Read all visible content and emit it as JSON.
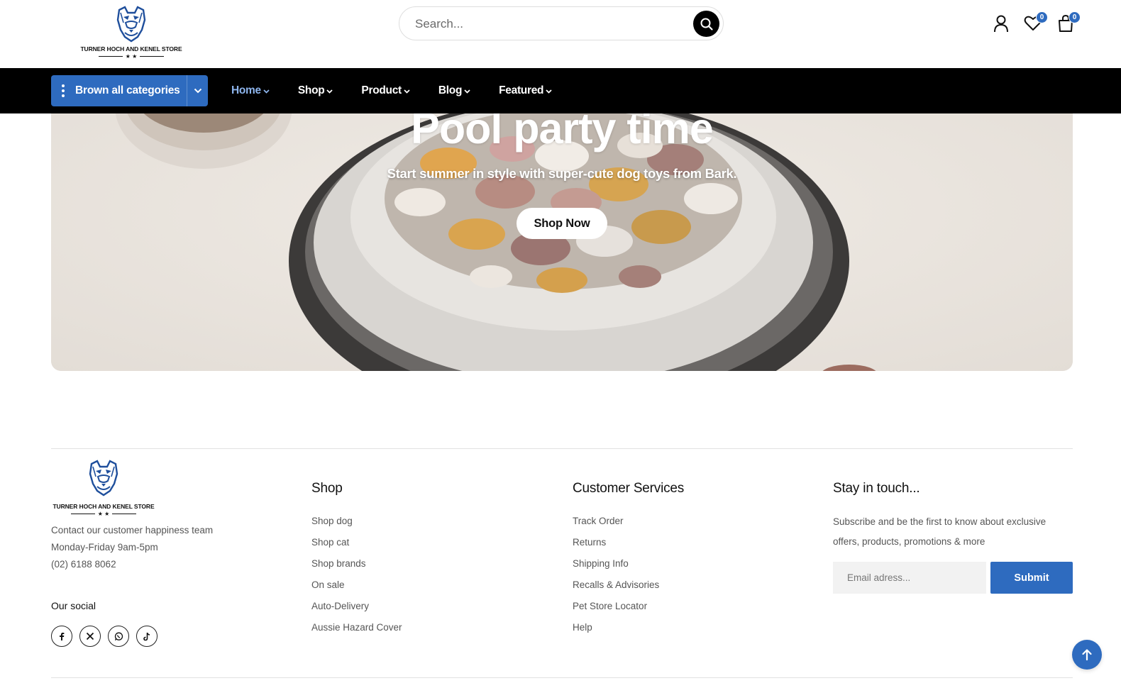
{
  "brand": {
    "name": "TURNER HOCH AND KENEL STORE",
    "accent_color": "#2e6bbf"
  },
  "header": {
    "search": {
      "placeholder": "Search...",
      "icon": "search-icon"
    },
    "icons": {
      "account": "user-icon",
      "wishlist": "heart-icon",
      "cart": "shopping-bag-icon"
    },
    "wishlist_count": "0",
    "cart_count": "0"
  },
  "nav": {
    "categories_label": "Brown all categories",
    "items": [
      {
        "label": "Home",
        "active": true
      },
      {
        "label": "Shop",
        "active": false
      },
      {
        "label": "Product",
        "active": false
      },
      {
        "label": "Blog",
        "active": false
      },
      {
        "label": "Featured",
        "active": false
      }
    ]
  },
  "hero": {
    "title": "Pool party time",
    "subtitle": "Start summer in style with super-cute dog toys from Bark.",
    "button": "Shop Now"
  },
  "footer": {
    "contact_lines": [
      "Contact our customer happiness team",
      "Monday-Friday 9am-5pm",
      "(02) 6188 8062"
    ],
    "social_title": "Our social",
    "social_icons": [
      "facebook-icon",
      "x-icon",
      "whatsapp-icon",
      "tiktok-icon"
    ],
    "shop": {
      "title": "Shop",
      "links": [
        "Shop dog",
        "Shop cat",
        "Shop brands",
        "On sale",
        "Auto-Delivery",
        "Aussie Hazard Cover"
      ]
    },
    "customer_services": {
      "title": "Customer Services",
      "links": [
        "Track Order",
        "Returns",
        "Shipping Info",
        "Recalls & Advisories",
        "Pet Store Locator",
        "Help"
      ]
    },
    "newsletter": {
      "title": "Stay in touch...",
      "text_line1": "Subscribe and be the first to know about exclusive",
      "text_line2": "offers, products, promotions & more",
      "email_placeholder": "Email adress...",
      "submit_label": "Submit"
    }
  }
}
